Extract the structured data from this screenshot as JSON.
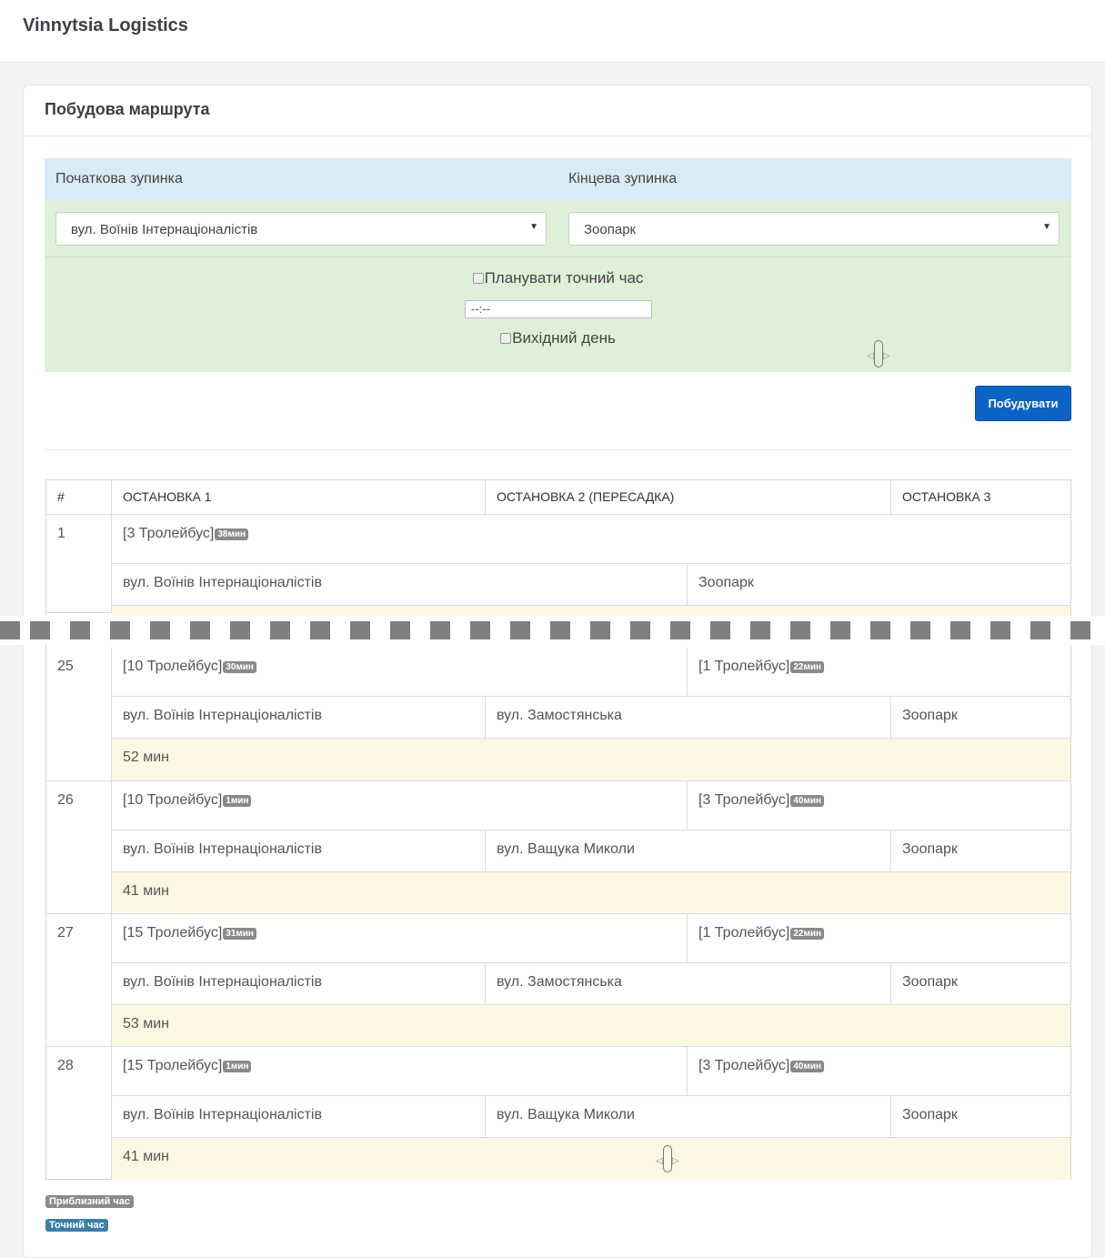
{
  "app": {
    "title": "Vinnytsia Logistics"
  },
  "panel": {
    "title": "Побудова маршрута"
  },
  "form": {
    "start_label": "Початкова зупинка",
    "end_label": "Кінцева зупинка",
    "start_value": "вул. Воїнів Інтернаціоналістів",
    "end_value": "Зоопарк",
    "plan_time_label": "Планувати точний час",
    "time_placeholder": "--:--",
    "weekend_label": "Вихідний день",
    "build_button": "Побудувати"
  },
  "table": {
    "headers": [
      "#",
      "ОСТАНОВКА 1",
      "ОСТАНОВКА 2 (ПЕРЕСАДКА)",
      "ОСТАНОВКА 3"
    ],
    "rows": [
      {
        "num": "1",
        "leg1": "[3 Тролейбус]",
        "leg1_time": "38мин",
        "stop1": "вул. Воїнів Інтернаціоналістів",
        "stop2": "Зоопарк"
      },
      {
        "num": "25",
        "leg1": "[10 Тролейбус]",
        "leg1_time": "30мин",
        "leg2": "[1 Тролейбус]",
        "leg2_time": "22мин",
        "stop1": "вул. Воїнів Інтернаціоналістів",
        "stop2": "вул. Замостянська",
        "stop3": "Зоопарк",
        "total": "52 мин"
      },
      {
        "num": "26",
        "leg1": "[10 Тролейбус]",
        "leg1_time": "1мин",
        "leg2": "[3 Тролейбус]",
        "leg2_time": "40мин",
        "stop1": "вул. Воїнів Інтернаціоналістів",
        "stop2": "вул. Ващука Миколи",
        "stop3": "Зоопарк",
        "total": "41 мин"
      },
      {
        "num": "27",
        "leg1": "[15 Тролейбус]",
        "leg1_time": "31мин",
        "leg2": "[1 Тролейбус]",
        "leg2_time": "22мин",
        "stop1": "вул. Воїнів Інтернаціоналістів",
        "stop2": "вул. Замостянська",
        "stop3": "Зоопарк",
        "total": "53 мин"
      },
      {
        "num": "28",
        "leg1": "[15 Тролейбус]",
        "leg1_time": "1мин",
        "leg2": "[3 Тролейбус]",
        "leg2_time": "40мин",
        "stop1": "вул. Воїнів Інтернаціоналістів",
        "stop2": "вул. Ващука Миколи",
        "stop3": "Зоопарк",
        "total": "41 мин"
      }
    ]
  },
  "legend": {
    "approx": "Приблизний час",
    "exact": "Точний час"
  },
  "colors": {
    "approx": "#8a8a8a",
    "exact": "#3a7fa8",
    "build_button": "#0b63c5",
    "form_head": "#d9ebf4",
    "form_body": "#dff0d8",
    "total_row": "#fcf8e3"
  }
}
